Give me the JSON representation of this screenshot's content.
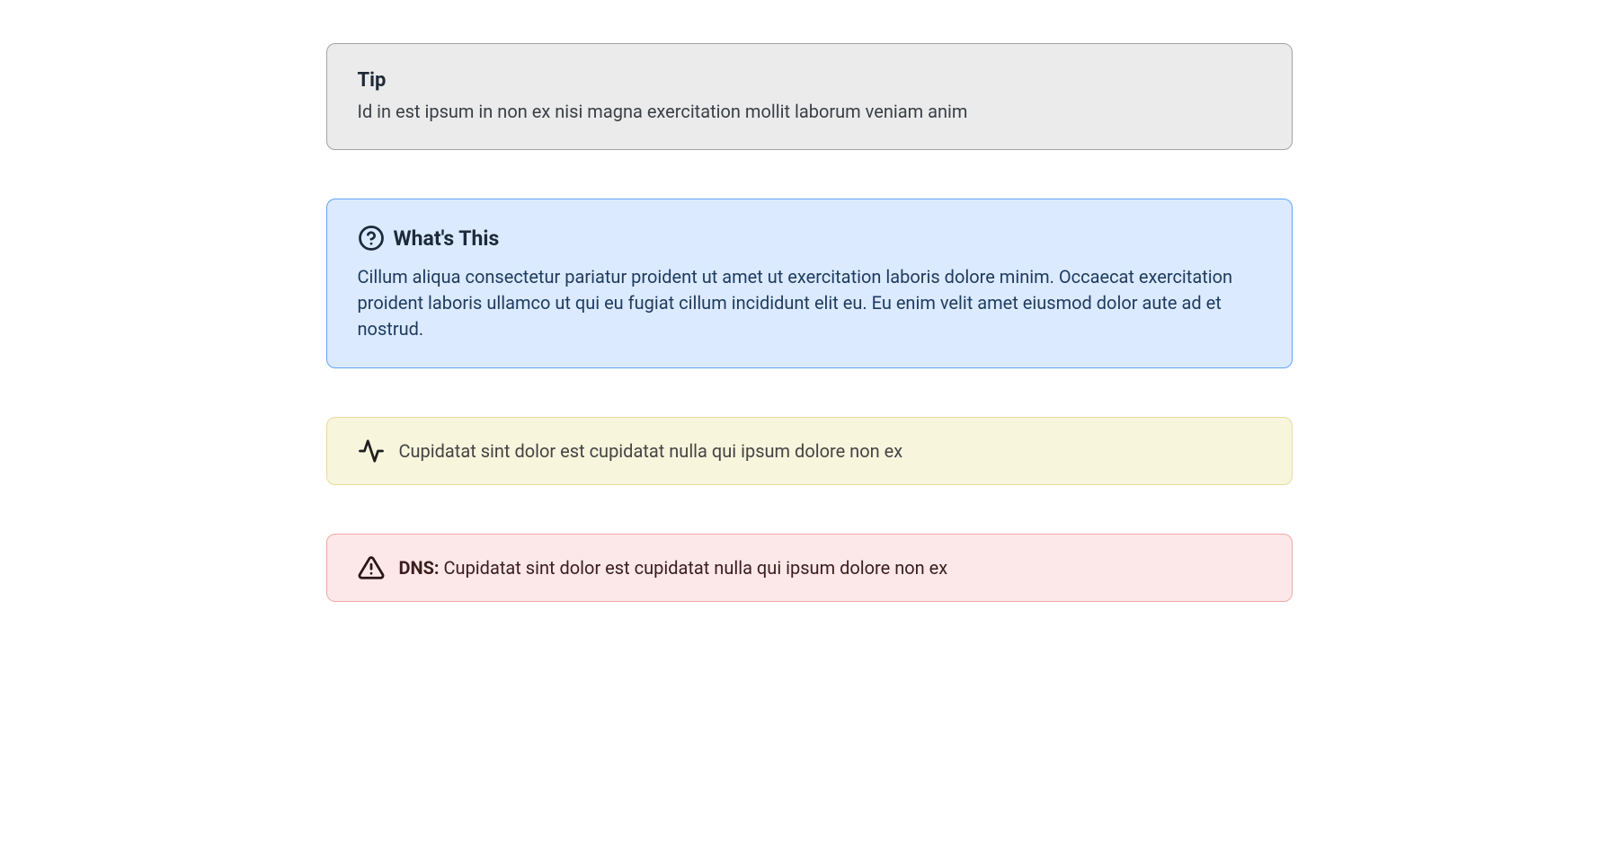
{
  "tip": {
    "title": "Tip",
    "body": "Id in est ipsum in non ex nisi magna exercitation mollit laborum veniam anim"
  },
  "info": {
    "title": "What's This",
    "body": "Cillum aliqua consectetur pariatur proident ut amet ut exercitation laboris dolore minim. Occaecat exercitation proident laboris ullamco ut qui eu fugiat cillum incididunt elit eu. Eu enim velit amet eiusmod dolor aute ad et nostrud."
  },
  "warn": {
    "body": "Cupidatat sint dolor est cupidatat nulla qui ipsum dolore non ex"
  },
  "danger": {
    "label": "DNS:",
    "body": "Cupidatat sint dolor est cupidatat nulla qui ipsum dolore non ex"
  }
}
